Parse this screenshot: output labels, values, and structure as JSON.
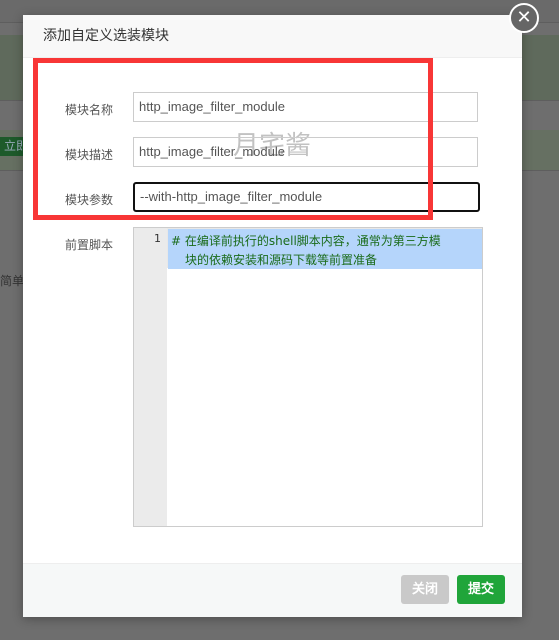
{
  "background": {
    "button_label": "立即",
    "text": "简单"
  },
  "dialog": {
    "title": "添加自定义选装模块",
    "fields": [
      {
        "label": "模块名称",
        "value": "http_image_filter_module"
      },
      {
        "label": "模块描述",
        "value": "http_image_filter_module"
      },
      {
        "label": "模块参数",
        "value": "--with-http_image_filter_module"
      }
    ],
    "script_label": "前置脚本",
    "script_line_number": "1",
    "script_lines": [
      "# 在编译前执行的shell脚本内容，通常为第三方模",
      "块的依赖安装和源码下载等前置准备"
    ],
    "close_label": "关闭",
    "submit_label": "提交"
  },
  "watermark": "月宅酱",
  "colors": {
    "submit": "#20a53a",
    "close_disabled": "#c9c9c9",
    "highlight_box": "#f83636"
  }
}
